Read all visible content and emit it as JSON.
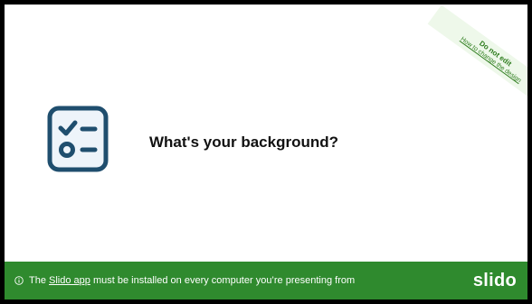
{
  "ribbon": {
    "title": "Do not edit",
    "link": "How to change the design"
  },
  "poll_icon": "checklist-icon",
  "question": "What's your background?",
  "footer": {
    "info_icon": "info-icon",
    "text_before": "The ",
    "link": "Slido app",
    "text_after": " must be installed on every computer you’re presenting from"
  },
  "brand": "slido",
  "colors": {
    "border": "#000000",
    "footer_bg": "#2f8a2e",
    "ribbon_bg": "#eef8ea",
    "ribbon_text": "#2e7d1e",
    "icon_stroke": "#1f4e6e",
    "icon_fill": "#eef4fa"
  }
}
